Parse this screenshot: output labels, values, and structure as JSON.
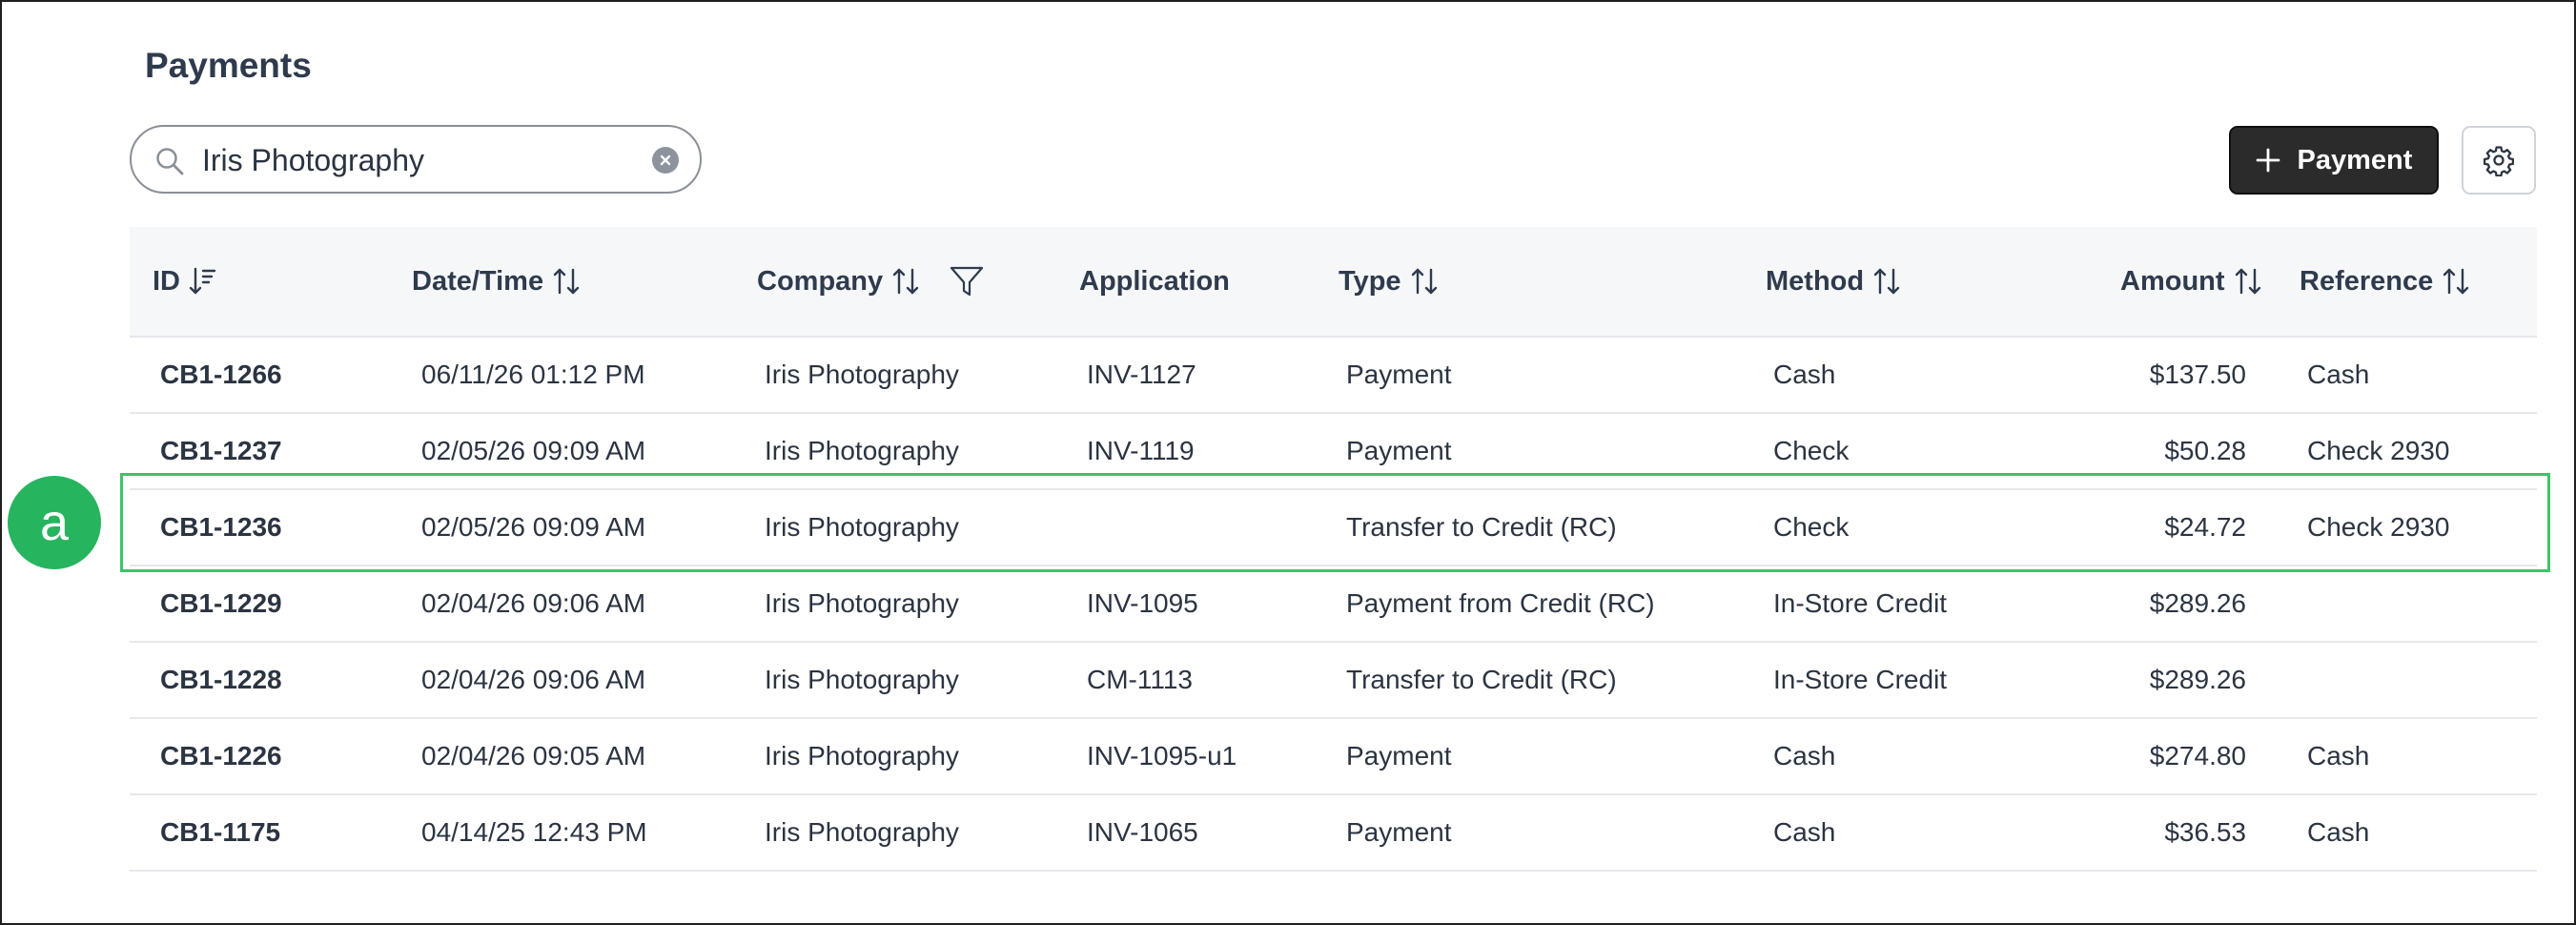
{
  "page": {
    "title": "Payments"
  },
  "search": {
    "value": "Iris Photography"
  },
  "toolbar": {
    "add_payment_label": "Payment"
  },
  "columns": {
    "id": "ID",
    "datetime": "Date/Time",
    "company": "Company",
    "application": "Application",
    "type": "Type",
    "method": "Method",
    "amount": "Amount",
    "reference": "Reference"
  },
  "rows": [
    {
      "id": "CB1-1266",
      "datetime": "06/11/26 01:12 PM",
      "company": "Iris Photography",
      "application": "INV-1127",
      "type": "Payment",
      "method": "Cash",
      "amount": "$137.50",
      "reference": "Cash"
    },
    {
      "id": "CB1-1237",
      "datetime": "02/05/26 09:09 AM",
      "company": "Iris Photography",
      "application": "INV-1119",
      "type": "Payment",
      "method": "Check",
      "amount": "$50.28",
      "reference": "Check 2930"
    },
    {
      "id": "CB1-1236",
      "datetime": "02/05/26 09:09 AM",
      "company": "Iris Photography",
      "application": "",
      "type": "Transfer to Credit (RC)",
      "method": "Check",
      "amount": "$24.72",
      "reference": "Check 2930"
    },
    {
      "id": "CB1-1229",
      "datetime": "02/04/26 09:06 AM",
      "company": "Iris Photography",
      "application": "INV-1095",
      "type": "Payment from Credit (RC)",
      "method": "In-Store Credit",
      "amount": "$289.26",
      "reference": ""
    },
    {
      "id": "CB1-1228",
      "datetime": "02/04/26 09:06 AM",
      "company": "Iris Photography",
      "application": "CM-1113",
      "type": "Transfer to Credit (RC)",
      "method": "In-Store Credit",
      "amount": "$289.26",
      "reference": ""
    },
    {
      "id": "CB1-1226",
      "datetime": "02/04/26 09:05 AM",
      "company": "Iris Photography",
      "application": "INV-1095-u1",
      "type": "Payment",
      "method": "Cash",
      "amount": "$274.80",
      "reference": "Cash"
    },
    {
      "id": "CB1-1175",
      "datetime": "04/14/25 12:43 PM",
      "company": "Iris Photography",
      "application": "INV-1065",
      "type": "Payment",
      "method": "Cash",
      "amount": "$36.53",
      "reference": "Cash"
    }
  ],
  "annotation": {
    "label": "a",
    "color": "#27b45e"
  },
  "colors": {
    "highlight": "#3cc46a",
    "primary_button": "#2b2b2b",
    "header_bg": "#f6f7f9"
  },
  "icons": [
    "search-icon",
    "clear-icon",
    "plus-icon",
    "gear-icon",
    "sort-desc-icon",
    "sort-icon",
    "filter-icon"
  ]
}
